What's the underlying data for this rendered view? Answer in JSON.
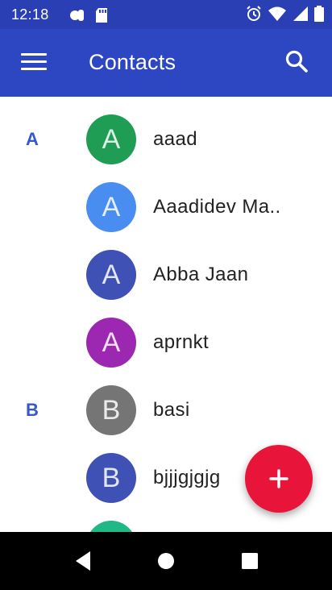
{
  "status_bar": {
    "time": "12:18",
    "left_icons": [
      "notification-app-icon",
      "sd-card-icon"
    ],
    "right_icons": [
      "alarm-icon",
      "wifi-icon",
      "signal-icon",
      "battery-icon"
    ]
  },
  "app_bar": {
    "title": "Contacts",
    "menu_icon": "hamburger-menu-icon",
    "search_icon": "search-icon"
  },
  "contacts": [
    {
      "section": "A",
      "initial": "A",
      "name": "aaad",
      "color": "#1f9d55"
    },
    {
      "section": "",
      "initial": "A",
      "name": "Aaadidev Ma..",
      "color": "#4a8df0"
    },
    {
      "section": "",
      "initial": "A",
      "name": "Abba Jaan",
      "color": "#3f51b5"
    },
    {
      "section": "",
      "initial": "A",
      "name": "aprnkt",
      "color": "#9c27b0"
    },
    {
      "section": "B",
      "initial": "B",
      "name": "basi",
      "color": "#757575"
    },
    {
      "section": "",
      "initial": "B",
      "name": "bjjjgjgjg",
      "color": "#3f51b5"
    },
    {
      "section": "",
      "initial": "",
      "name": "",
      "color": "#1fb886"
    }
  ],
  "fab": {
    "icon": "plus-icon",
    "color": "#e8143a"
  },
  "nav_bar": {
    "back": "back-icon",
    "home": "home-icon",
    "recents": "recents-icon"
  }
}
